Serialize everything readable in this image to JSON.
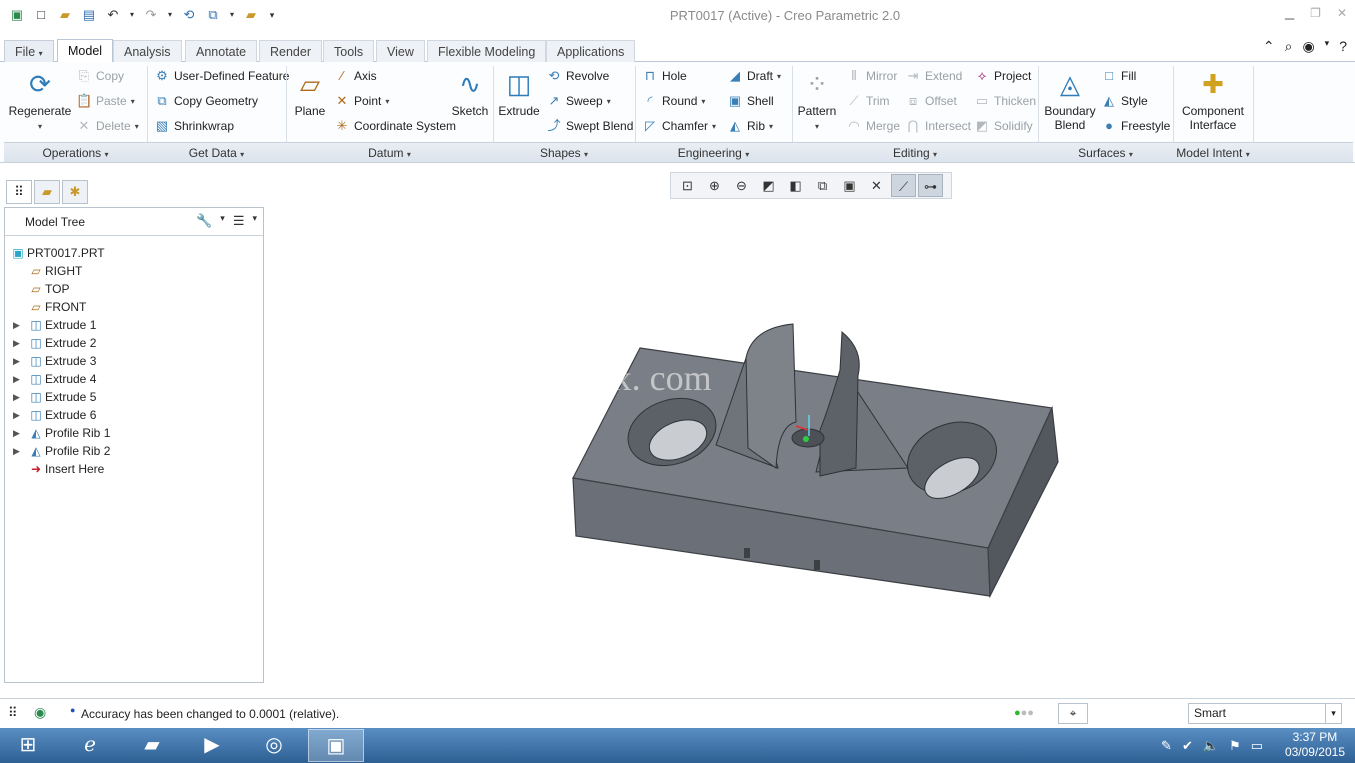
{
  "window": {
    "title": "PRT0017 (Active) - Creo Parametric 2.0"
  },
  "qat": {
    "new": "□",
    "open": "▣",
    "save": "💾",
    "undo": "↶",
    "redo": "↷",
    "regen": "⟳",
    "window": "⧉",
    "close": "✖",
    "more": "▾"
  },
  "tabs": [
    "File",
    "Model",
    "Analysis",
    "Annotate",
    "Render",
    "Tools",
    "View",
    "Flexible Modeling",
    "Applications"
  ],
  "ribbon": {
    "operations": {
      "regenerate": "Regenerate",
      "copy": "Copy",
      "paste": "Paste",
      "delete": "Delete",
      "group": "Operations"
    },
    "getdata": {
      "udf": "User-Defined Feature",
      "copy_geom": "Copy Geometry",
      "shrinkwrap": "Shrinkwrap",
      "group": "Get Data"
    },
    "datum": {
      "plane": "Plane",
      "axis": "Axis",
      "point": "Point",
      "csys": "Coordinate System",
      "sketch": "Sketch",
      "group": "Datum"
    },
    "shapes": {
      "extrude": "Extrude",
      "revolve": "Revolve",
      "sweep": "Sweep",
      "swept_blend": "Swept Blend",
      "group": "Shapes"
    },
    "engineering": {
      "hole": "Hole",
      "round": "Round",
      "chamfer": "Chamfer",
      "draft": "Draft",
      "shell": "Shell",
      "rib": "Rib",
      "group": "Engineering"
    },
    "editing": {
      "pattern": "Pattern",
      "mirror": "Mirror",
      "trim": "Trim",
      "merge": "Merge",
      "extend": "Extend",
      "offset": "Offset",
      "intersect": "Intersect",
      "project": "Project",
      "thicken": "Thicken",
      "solidify": "Solidify",
      "group": "Editing"
    },
    "surfaces": {
      "boundary1": "Boundary",
      "boundary2": "Blend",
      "fill": "Fill",
      "style": "Style",
      "freestyle": "Freestyle",
      "group": "Surfaces"
    },
    "intent": {
      "comp1": "Component",
      "comp2": "Interface",
      "group": "Model Intent"
    }
  },
  "tree": {
    "header": "Model Tree",
    "items": [
      {
        "label": "PRT0017.PRT",
        "level": 0,
        "expandable": false
      },
      {
        "label": "RIGHT",
        "level": 1,
        "expandable": false
      },
      {
        "label": "TOP",
        "level": 1,
        "expandable": false
      },
      {
        "label": "FRONT",
        "level": 1,
        "expandable": false
      },
      {
        "label": "Extrude 1",
        "level": 1,
        "expandable": true
      },
      {
        "label": "Extrude 2",
        "level": 1,
        "expandable": true
      },
      {
        "label": "Extrude 3",
        "level": 1,
        "expandable": true
      },
      {
        "label": "Extrude 4",
        "level": 1,
        "expandable": true
      },
      {
        "label": "Extrude 5",
        "level": 1,
        "expandable": true
      },
      {
        "label": "Extrude 6",
        "level": 1,
        "expandable": true
      },
      {
        "label": "Profile Rib 1",
        "level": 1,
        "expandable": true
      },
      {
        "label": "Profile Rib 2",
        "level": 1,
        "expandable": true
      },
      {
        "label": "Insert Here",
        "level": 1,
        "expandable": false
      }
    ]
  },
  "watermark": "www. 3dmox. com",
  "status": {
    "message": "Accuracy has been changed to 0.0001  (relative).",
    "filter": "Smart"
  },
  "taskbar": {
    "time": "3:37 PM",
    "date": "03/09/2015"
  }
}
